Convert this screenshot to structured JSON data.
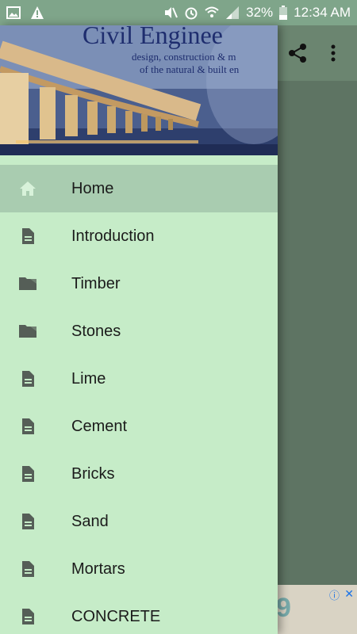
{
  "status_bar": {
    "battery_percent": "32%",
    "time": "12:34 AM",
    "left_icons": [
      "image-icon",
      "warning-icon"
    ],
    "right_icons": [
      "mute-icon",
      "alarm-icon",
      "wifi-icon",
      "signal-icon",
      "battery-icon"
    ]
  },
  "drawer": {
    "header": {
      "title": "Civil Enginee",
      "subtitle_line1": "design, construction & m",
      "subtitle_line2": "of the natural & built en"
    },
    "items": [
      {
        "label": "Home",
        "icon": "home-icon",
        "active": true
      },
      {
        "label": "Introduction",
        "icon": "document-icon"
      },
      {
        "label": "Timber",
        "icon": "folder-icon"
      },
      {
        "label": "Stones",
        "icon": "folder-icon"
      },
      {
        "label": "Lime",
        "icon": "document-icon"
      },
      {
        "label": "Cement",
        "icon": "document-icon"
      },
      {
        "label": "Bricks",
        "icon": "document-icon"
      },
      {
        "label": "Sand",
        "icon": "document-icon"
      },
      {
        "label": "Mortars",
        "icon": "document-icon"
      },
      {
        "label": "CONCRETE",
        "icon": "document-icon"
      }
    ]
  },
  "toolbar": {
    "icons": [
      "share-icon",
      "more-vert-icon"
    ]
  },
  "ad": {
    "digit": "9",
    "info": "ⓘ",
    "close": "✕"
  },
  "colors": {
    "status_bar": "#7fa58a",
    "drawer_bg": "#c6ecc8",
    "active_item_bg": "#a9ccb0",
    "scrim": "#5e7463",
    "icon": "#555e57"
  }
}
